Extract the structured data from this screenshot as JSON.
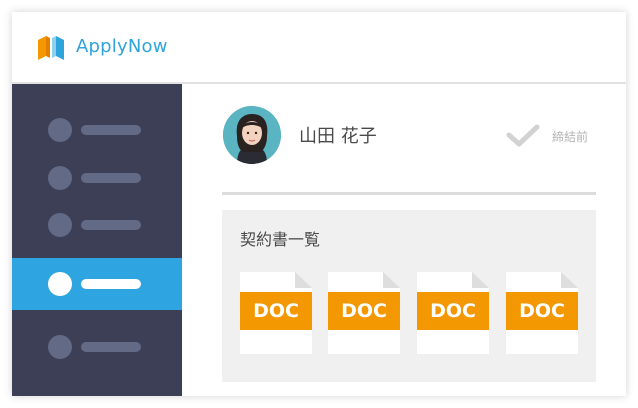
{
  "app": {
    "name": "ApplyNow",
    "brand_color": "#2fa3dc",
    "logo_colors": [
      "#f39800",
      "#2fa3dc"
    ]
  },
  "sidebar": {
    "items": [
      {
        "icon": "circle-icon",
        "active": false
      },
      {
        "icon": "circle-icon",
        "active": false
      },
      {
        "icon": "circle-icon",
        "active": false
      },
      {
        "icon": "circle-icon",
        "active": true
      },
      {
        "icon": "circle-icon",
        "active": false
      }
    ],
    "background": "#3c3f55",
    "active_color": "#2ea5e0"
  },
  "user": {
    "name": "山田 花子",
    "status": "締結前",
    "status_icon": "checkmark-icon"
  },
  "documents": {
    "title": "契約書一覧",
    "items": [
      {
        "label": "DOC"
      },
      {
        "label": "DOC"
      },
      {
        "label": "DOC"
      },
      {
        "label": "DOC"
      }
    ],
    "badge_color": "#f39800"
  }
}
